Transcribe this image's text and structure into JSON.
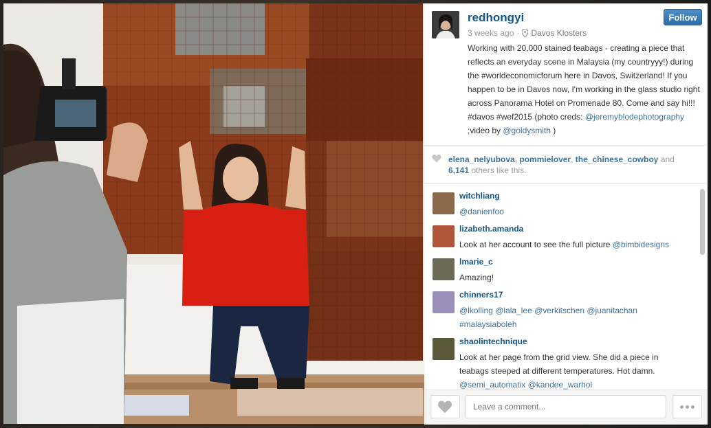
{
  "post": {
    "username": "redhongyi",
    "time": "3 weeks ago",
    "separator": "·",
    "location": "Davos Klosters",
    "follow_label": "Follow",
    "caption_parts": [
      {
        "type": "text",
        "value": "Working with 20,000 stained teabags - creating a piece that reflects an everyday scene in Malaysia (my countryyy!) during the #worldeconomicforum here in Davos, Switzerland! If you happen to be in Davos now, I'm working in the glass studio right across Panorama Hotel on Promenade 80. Come and say hi!!! #davos #wef2015 (photo creds: "
      },
      {
        "type": "link",
        "value": "@jeremyblodephotography"
      },
      {
        "type": "text",
        "value": " ;video by "
      },
      {
        "type": "link",
        "value": "@goldysmith"
      },
      {
        "type": "text",
        "value": " )"
      }
    ]
  },
  "likes": {
    "users": [
      "elena_nelyubova",
      "pommielover",
      "the_chinese_cowboy"
    ],
    "separator": ", ",
    "and_text": " and ",
    "count": "6,141",
    "suffix": " others like this."
  },
  "comments": [
    {
      "user": "witchliang",
      "text": "@danienfoo",
      "avatar_color": "#8a6a4a"
    },
    {
      "user": "lizabeth.amanda",
      "text": "Look at her account to see the full picture @bimbidesigns",
      "avatar_color": "#b0563a"
    },
    {
      "user": "lmarie_c",
      "text": "Amazing!",
      "avatar_color": "#6b6a55"
    },
    {
      "user": "chinners17",
      "text": "@lkolling @lala_lee @verkitschen @juanitachan #malaysiaboleh",
      "avatar_color": "#9a8fb8"
    },
    {
      "user": "shaolintechnique",
      "text": "Look at her page from the grid view. She did a piece in teabags steeped at different temperatures. Hot damn. @semi_automatix @kandee_warhol",
      "avatar_color": "#5a5a3a"
    }
  ],
  "footer": {
    "comment_placeholder": "Leave a comment..."
  },
  "icons": {
    "location": "location-pin-icon",
    "heart": "heart-icon",
    "more": "more-dots-icon"
  },
  "colors": {
    "link": "#3f729b",
    "username": "#125688",
    "follow": "#3f81bd"
  }
}
